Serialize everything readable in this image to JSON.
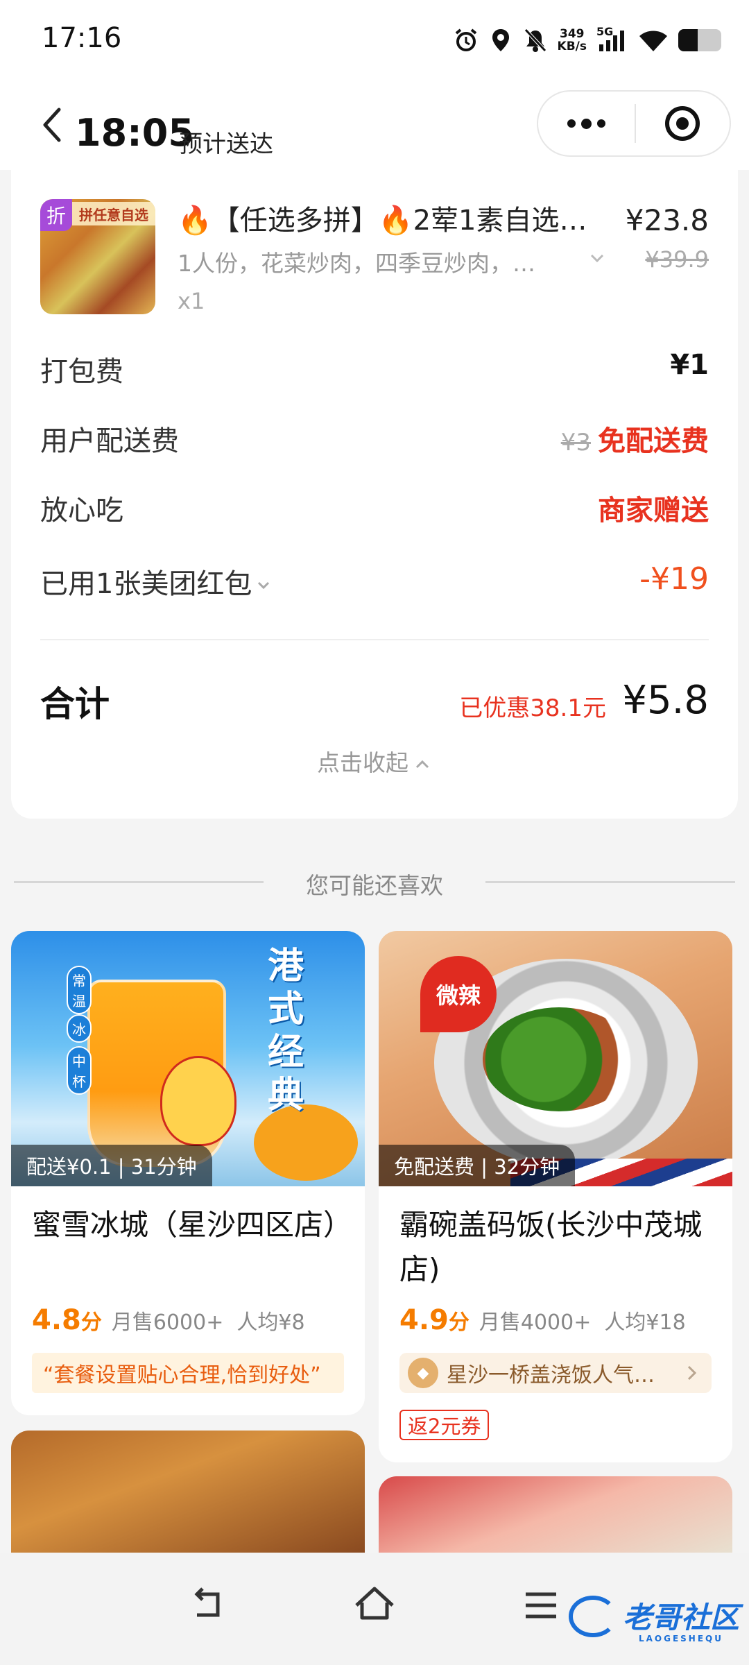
{
  "status_bar": {
    "time": "17:16",
    "net_speed_value": "349",
    "net_speed_unit": "KB/s",
    "network": "5G",
    "battery_level": 0.45
  },
  "header": {
    "eta_time": "18:05",
    "eta_label": "预计送达"
  },
  "order": {
    "item": {
      "thumb_tag": "折",
      "thumb_banner": "拼任意自选",
      "name": "🔥【任选多拼】🔥2荤1素自选…",
      "desc": "1人份，花菜炒肉，四季豆炒肉，…",
      "qty": "x1",
      "price": "¥23.8",
      "original_price": "¥39.9"
    },
    "packing": {
      "label": "打包费",
      "value": "¥1"
    },
    "delivery": {
      "label": "用户配送费",
      "original": "¥3",
      "value": "免配送费"
    },
    "assurance": {
      "label": "放心吃",
      "value": "商家赠送"
    },
    "coupon": {
      "label": "已用1张美团红包",
      "value": "-¥19"
    },
    "total": {
      "label": "合计",
      "saved": "已优惠38.1元",
      "amount": "¥5.8"
    },
    "collapse_label": "点击收起"
  },
  "recommend": {
    "title": "您可能还喜欢",
    "shops": [
      {
        "photo_text": "港式经典",
        "photo_tags": [
          "常温",
          "冰",
          "中杯"
        ],
        "badge": "配送¥0.1 | 31分钟",
        "name": "蜜雪冰城（星沙四区店）",
        "score": "4.8",
        "score_unit": "分",
        "monthly_sales": "月售6000+",
        "avg_price": "人均¥8",
        "quote": "“套餐设置贴心合理,恰到好处”"
      },
      {
        "photo_text": "微辣",
        "badge": "免配送费 | 32分钟",
        "name": "霸碗盖码饭(长沙中茂城店)",
        "score": "4.9",
        "score_unit": "分",
        "monthly_sales": "月售4000+",
        "avg_price": "人均¥18",
        "rank": "星沙一桥盖浇饭人气…",
        "coupon": "返2元券"
      }
    ]
  },
  "watermark": {
    "text": "老哥社区",
    "sub": "LAOGESHEQU"
  },
  "colors": {
    "accent_red": "#e8321f",
    "score_orange": "#f57c00",
    "background": "#f4f4f4"
  }
}
